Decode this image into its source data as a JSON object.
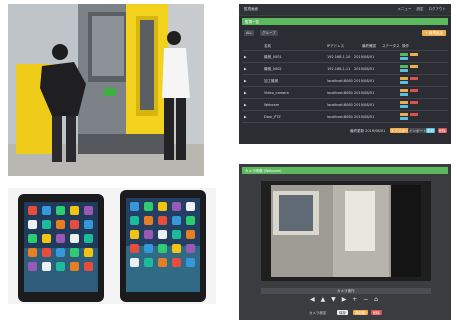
{
  "dashboard": {
    "app_title": "監視画面",
    "nav": [
      "メニュー",
      "設定",
      "ログアウト"
    ],
    "section_title": "監視一覧",
    "toolbar": {
      "filter_label": "ALL",
      "group_label": "グループ",
      "add_button": "+ 新規追加"
    },
    "columns": [
      "",
      "名前",
      "IPアドレス",
      "最終確認",
      "ステータス",
      "操作"
    ],
    "rows": [
      {
        "name": "機械_0001",
        "ip": "192.168.1.10",
        "date": "2019/08/01",
        "status": "稼働中"
      },
      {
        "name": "機械_0002",
        "ip": "192.168.1.11",
        "date": "2019/08/01",
        "status": "稼働中"
      },
      {
        "name": "加工機械",
        "ip": "localhost:8080",
        "date": "2019/08/01",
        "status": "稼働中"
      },
      {
        "name": "Video_camera",
        "ip": "localhost:8080",
        "date": "2019/08/01",
        "status": "稼働中"
      },
      {
        "name": "Webcam",
        "ip": "localhost:8080",
        "date": "2019/08/01",
        "status": "稼働中"
      },
      {
        "name": "Door_PTZ",
        "ip": "localhost:8080",
        "date": "2019/08/01",
        "status": "稼働中"
      }
    ],
    "footer": {
      "info": "最終更新 2019/08/01",
      "buttons": [
        "エクスポート",
        "インポート",
        "更新",
        "削除"
      ]
    },
    "colors": {
      "green": "#5cb85c",
      "orange": "#f0ad4e",
      "blue": "#5bc0de",
      "red": "#d9534f"
    }
  },
  "camera": {
    "section_title": "カメラ映像 (Webcam)",
    "control_label": "カメラ操作",
    "arrows": [
      "◀",
      "▲",
      "▼",
      "▶",
      "+",
      "−",
      "⌂"
    ],
    "bottom_label": "カメラ設定",
    "buttons": [
      "保存",
      "再起動",
      "削除"
    ]
  }
}
